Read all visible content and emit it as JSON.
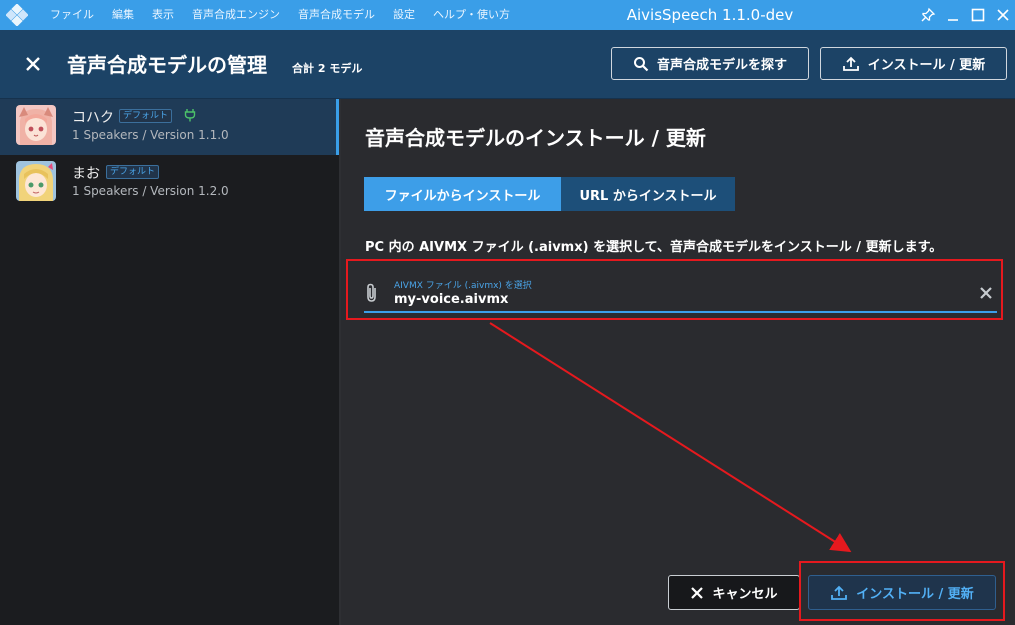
{
  "titlebar": {
    "menu": [
      "ファイル",
      "編集",
      "表示",
      "音声合成エンジン",
      "音声合成モデル",
      "設定",
      "ヘルプ・使い方"
    ],
    "app_title": "AivisSpeech 1.1.0-dev",
    "icons": [
      "app-logo-icon",
      "pin-icon",
      "minimize-icon",
      "maximize-icon",
      "window-close-icon"
    ]
  },
  "header": {
    "title": "音声合成モデルの管理",
    "total": "合計 2 モデル",
    "search_button": "音声合成モデルを探す",
    "install_button": "インストール / 更新"
  },
  "models": [
    {
      "name": "コハク",
      "badge": "デフォルト",
      "meta": "1 Speakers / Version 1.1.0",
      "selected": true
    },
    {
      "name": "まお",
      "badge": "デフォルト",
      "meta": "1 Speakers / Version 1.2.0",
      "selected": false
    }
  ],
  "panel": {
    "title": "音声合成モデルのインストール / 更新",
    "tab_file": "ファイルからインストール",
    "tab_url": "URL からインストール",
    "description": "PC 内の AIVMX ファイル (.aivmx) を選択して、音声合成モデルをインストール / 更新します。",
    "field_label": "AIVMX ファイル (.aivmx) を選択",
    "field_value": "my-voice.aivmx",
    "cancel_button": "キャンセル",
    "install_button": "インストール / 更新"
  },
  "colors": {
    "accent": "#3a9ee8",
    "header_bg": "#1c4366",
    "annotation": "#e5191e"
  }
}
